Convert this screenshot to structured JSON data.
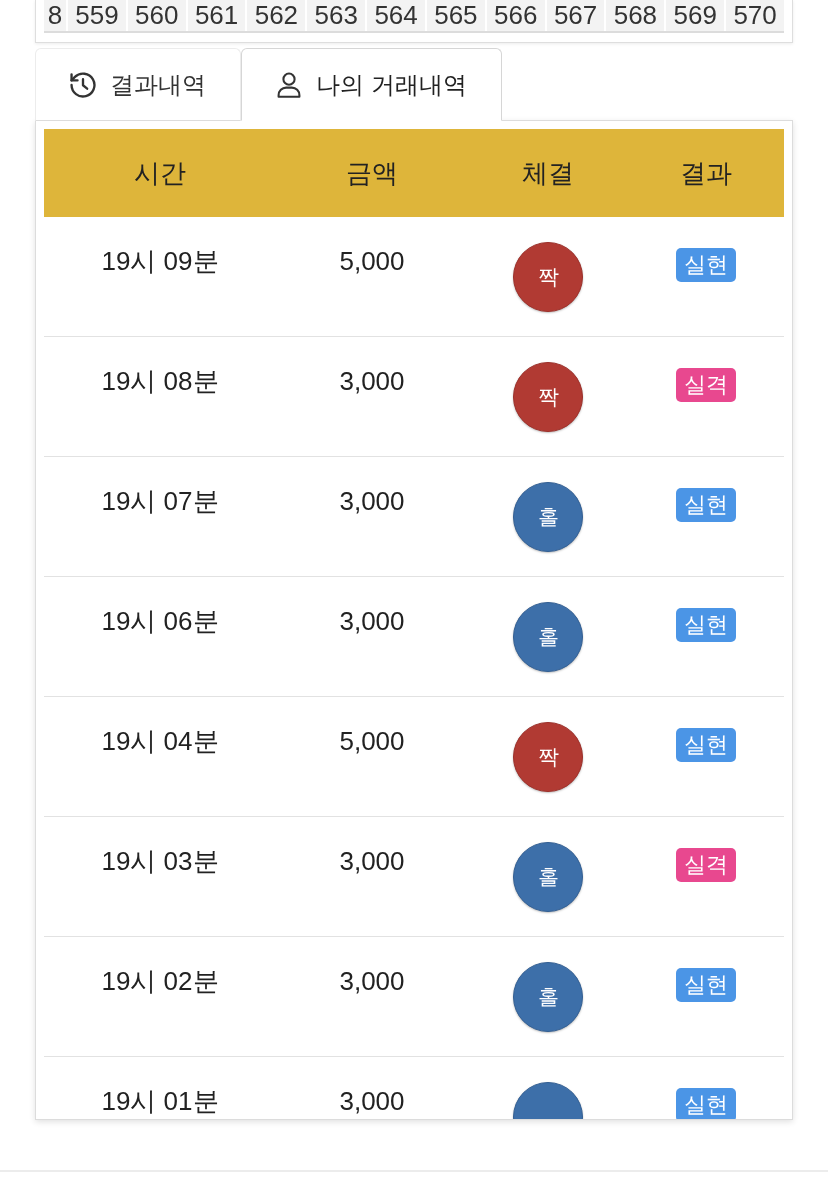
{
  "round_strip": {
    "cells": [
      "8",
      "559",
      "560",
      "561",
      "562",
      "563",
      "564",
      "565",
      "566",
      "567",
      "568",
      "569",
      "570"
    ]
  },
  "tabs": [
    {
      "label": "결과내역",
      "selected": false
    },
    {
      "label": "나의 거래내역",
      "selected": true
    }
  ],
  "table": {
    "columns": [
      "시간",
      "금액",
      "체결",
      "결과"
    ],
    "rows": [
      {
        "time": "19시 09분",
        "amount": "5,000",
        "pick": {
          "label": "짝",
          "kind": "even"
        },
        "result": {
          "label": "실현",
          "kind": "win"
        }
      },
      {
        "time": "19시 08분",
        "amount": "3,000",
        "pick": {
          "label": "짝",
          "kind": "even"
        },
        "result": {
          "label": "실격",
          "kind": "lose"
        }
      },
      {
        "time": "19시 07분",
        "amount": "3,000",
        "pick": {
          "label": "홀",
          "kind": "odd"
        },
        "result": {
          "label": "실현",
          "kind": "win"
        }
      },
      {
        "time": "19시 06분",
        "amount": "3,000",
        "pick": {
          "label": "홀",
          "kind": "odd"
        },
        "result": {
          "label": "실현",
          "kind": "win"
        }
      },
      {
        "time": "19시 04분",
        "amount": "5,000",
        "pick": {
          "label": "짝",
          "kind": "even"
        },
        "result": {
          "label": "실현",
          "kind": "win"
        }
      },
      {
        "time": "19시 03분",
        "amount": "3,000",
        "pick": {
          "label": "홀",
          "kind": "odd"
        },
        "result": {
          "label": "실격",
          "kind": "lose"
        }
      },
      {
        "time": "19시 02분",
        "amount": "3,000",
        "pick": {
          "label": "홀",
          "kind": "odd"
        },
        "result": {
          "label": "실현",
          "kind": "win"
        }
      },
      {
        "time": "19시 01분",
        "amount": "3,000",
        "pick": {
          "kind": "odd"
        },
        "result": {
          "label": "실현",
          "kind": "win"
        }
      }
    ]
  }
}
